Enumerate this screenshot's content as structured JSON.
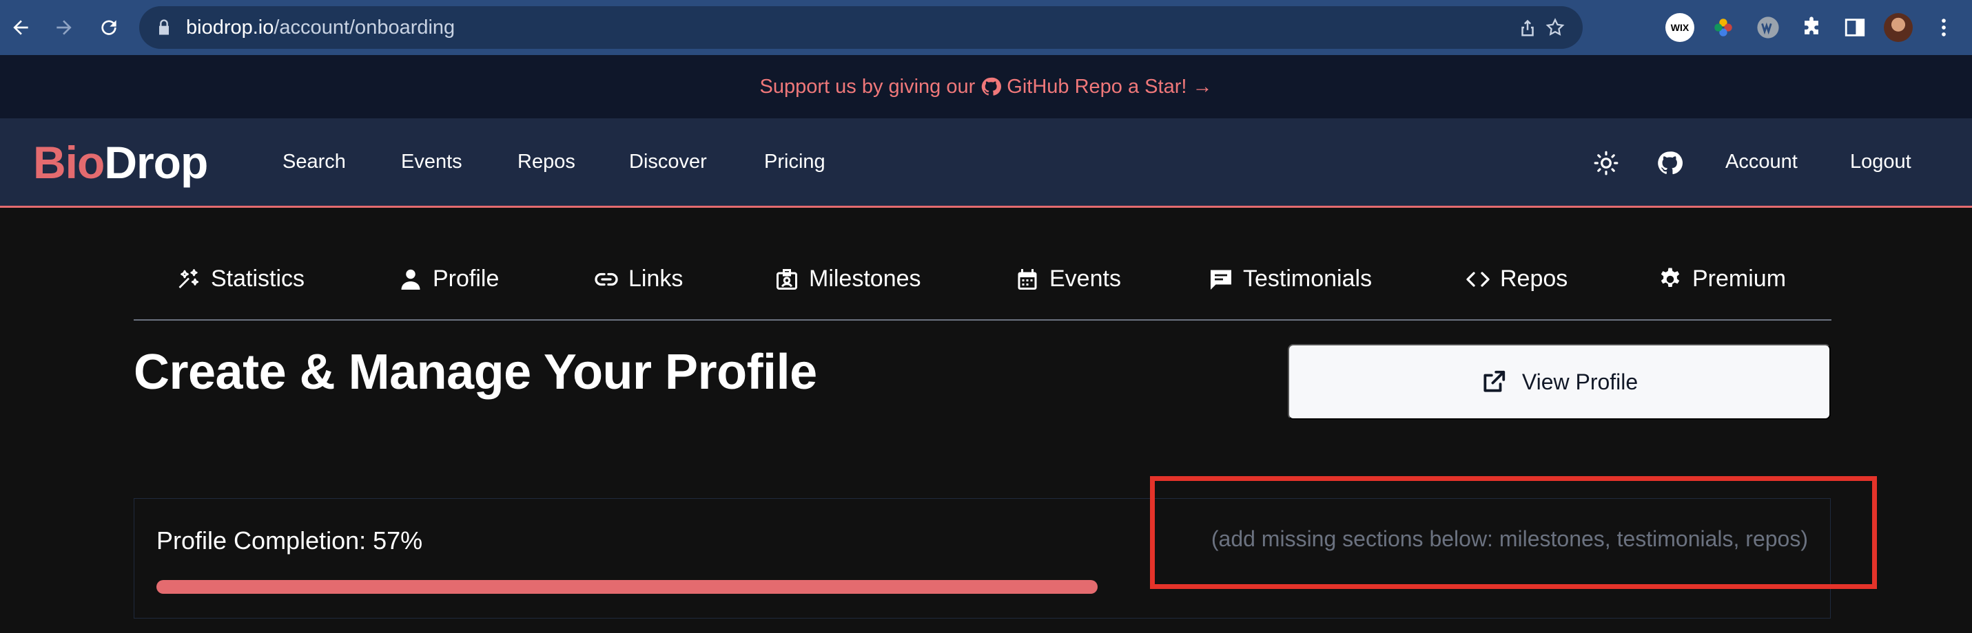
{
  "browser": {
    "url_host": "biodrop.io",
    "url_path": "/account/onboarding",
    "icons": [
      "back-arrow-icon",
      "forward-arrow-icon",
      "reload-icon",
      "lock-icon",
      "share-icon",
      "star-icon",
      "wix-extension-icon",
      "color-wheel-extension-icon",
      "w-extension-icon",
      "puzzle-icon",
      "side-panel-icon",
      "avatar",
      "kebab-menu-icon"
    ],
    "wix_label": "WIX"
  },
  "banner": {
    "text_before": "Support us by giving our",
    "text_after": "GitHub Repo a Star! →",
    "color": "#f0787a"
  },
  "nav": {
    "logo_bio": "Bio",
    "logo_drop": "Drop",
    "items": [
      "Search",
      "Events",
      "Repos",
      "Discover",
      "Pricing"
    ],
    "right": [
      "Account",
      "Logout"
    ]
  },
  "tabs": [
    {
      "label": "Statistics",
      "icon": "sparkles-icon"
    },
    {
      "label": "Profile",
      "icon": "user-icon"
    },
    {
      "label": "Links",
      "icon": "link-icon"
    },
    {
      "label": "Milestones",
      "icon": "id-badge-icon"
    },
    {
      "label": "Events",
      "icon": "calendar-icon"
    },
    {
      "label": "Testimonials",
      "icon": "chat-icon"
    },
    {
      "label": "Repos",
      "icon": "code-icon"
    },
    {
      "label": "Premium",
      "icon": "gear-icon"
    }
  ],
  "page": {
    "title": "Create & Manage Your Profile",
    "view_profile": "View Profile"
  },
  "completion": {
    "label": "Profile Completion: 57%",
    "percent": 57,
    "hint": "(add missing sections below: milestones, testimonials, repos)"
  },
  "colors": {
    "accent": "#e46b6f",
    "highlight": "#e5332a"
  }
}
